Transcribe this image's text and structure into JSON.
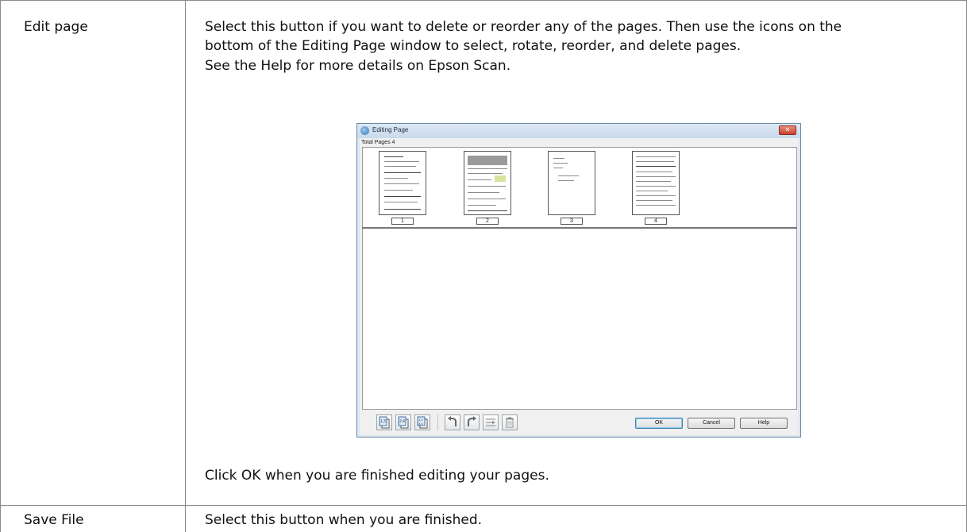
{
  "rows": [
    {
      "label": "Edit page",
      "description": [
        "Select this button if you want to delete or reorder any of the pages. Then use the icons on the",
        "bottom of the Editing Page window to select, rotate, reorder, and delete pages.",
        "See the Help for more details on Epson Scan."
      ],
      "footer": "Click OK when you are finished editing your pages."
    },
    {
      "label": "Save File",
      "description": "Select this button when you are finished."
    }
  ],
  "dialog": {
    "title": "Editing Page",
    "close_glyph": "✕",
    "total_pages": "Total Pages 4",
    "pages": [
      "1",
      "2",
      "3",
      "4"
    ],
    "toolbar_icons": [
      "select-odd-pages-icon",
      "select-even-pages-icon",
      "select-all-pages-icon",
      "rotate-left-icon",
      "rotate-right-icon",
      "reorder-icon",
      "delete-icon"
    ],
    "buttons": {
      "ok": "OK",
      "cancel": "Cancel",
      "help": "Help"
    }
  }
}
